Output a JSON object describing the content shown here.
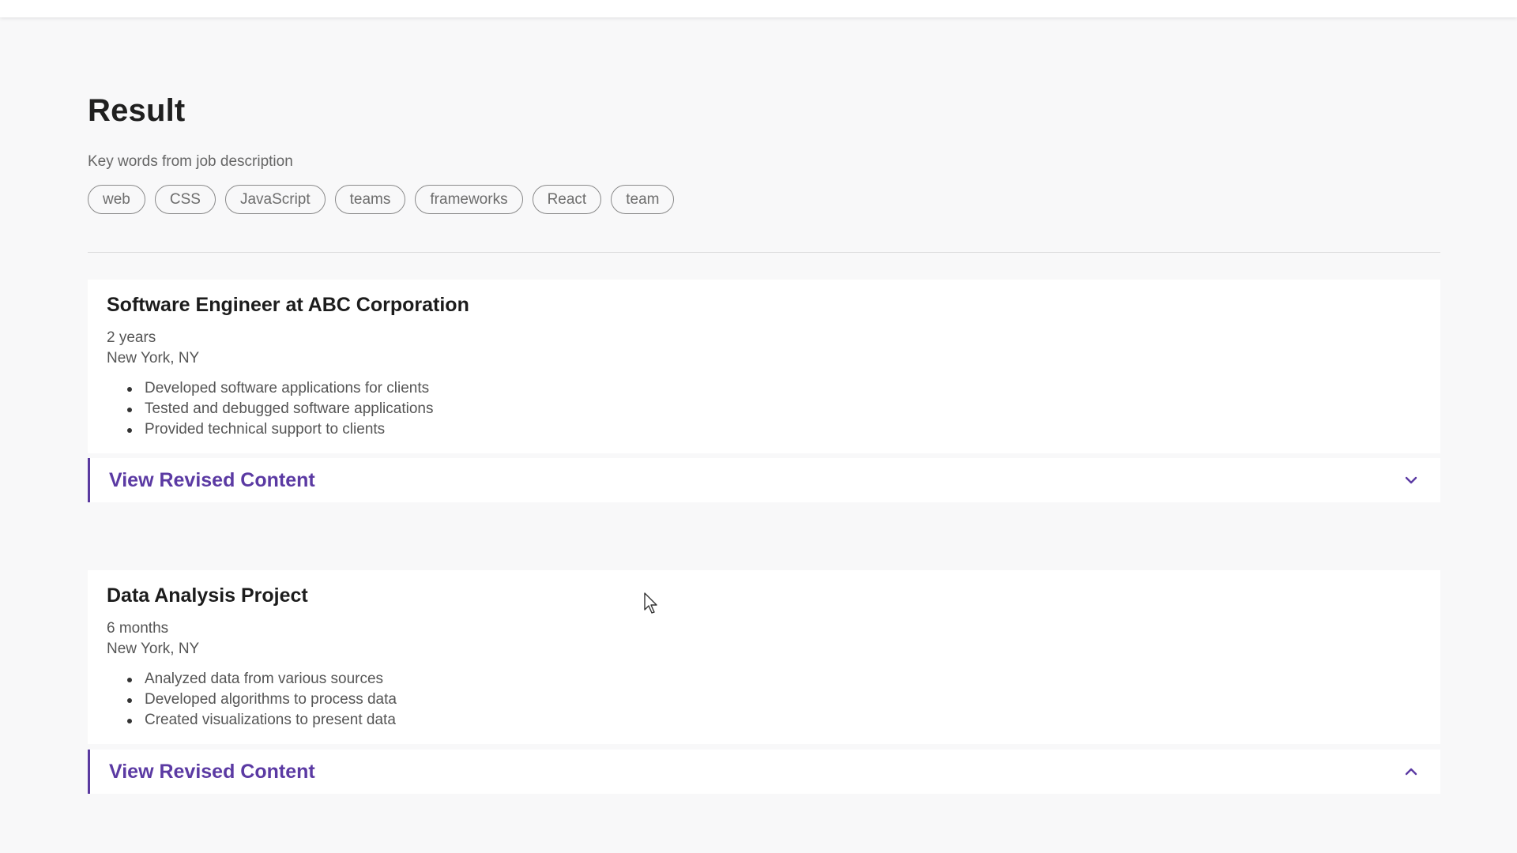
{
  "page": {
    "title": "Result"
  },
  "keywords": {
    "label": "Key words from job description",
    "items": [
      "web",
      "CSS",
      "JavaScript",
      "teams",
      "frameworks",
      "React",
      "team"
    ]
  },
  "entries": [
    {
      "title": "Software Engineer at ABC Corporation",
      "duration": "2 years",
      "location": "New York, NY",
      "bullets": [
        "Developed software applications for clients",
        "Tested and debugged software applications",
        "Provided technical support to clients"
      ],
      "revise_label": "View Revised Content",
      "expanded": false,
      "chevron_icon": "chevron-down-icon"
    },
    {
      "title": "Data Analysis Project",
      "duration": "6 months",
      "location": "New York, NY",
      "bullets": [
        "Analyzed data from various sources",
        "Developed algorithms to process data",
        "Created visualizations to present data"
      ],
      "revise_label": "View Revised Content",
      "expanded": true,
      "chevron_icon": "chevron-up-icon"
    }
  ],
  "colors": {
    "accent": "#5b3aa3",
    "background": "#f8f8f9",
    "card": "#ffffff"
  }
}
